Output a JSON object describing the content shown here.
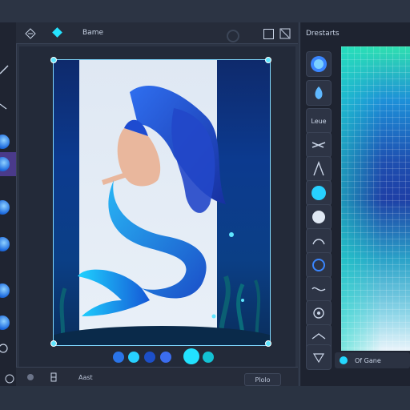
{
  "topbar": {
    "label": "Bame"
  },
  "status": {
    "left_text": "Aast",
    "button_label": "Plolo"
  },
  "right_panel": {
    "title": "Drestarts",
    "brush_text": "Leue",
    "picker_text": "Of Gane"
  },
  "swatches": [
    "#2a74e8",
    "#27d0ff",
    "#1c4fc9",
    "#3b6df0",
    "#22e2ff",
    "#13c2d4"
  ],
  "icons": {
    "top": [
      "brand-icon",
      "gem-icon",
      "search-icon",
      "save-icon",
      "shrink-icon"
    ],
    "left_tools": [
      "pen-icon",
      "wave-icon",
      "brush-icon",
      "stamp-icon",
      "orb-icon",
      "orb-icon",
      "orb-icon",
      "orb-icon",
      "orb-icon",
      "orb-icon",
      "ring-icon"
    ],
    "brushes": [
      "sphere-brush-icon",
      "drop-brush-icon",
      "text-brush-icon",
      "stroke-brush-icon",
      "spike-brush-icon",
      "circle-brush-icon",
      "dot-brush-icon",
      "splash-brush-icon",
      "swirl-brush-icon",
      "wave-brush-icon",
      "eye-brush-icon",
      "bird-brush-icon",
      "crystal-brush-icon"
    ]
  },
  "accent_color": "#26e3ff"
}
